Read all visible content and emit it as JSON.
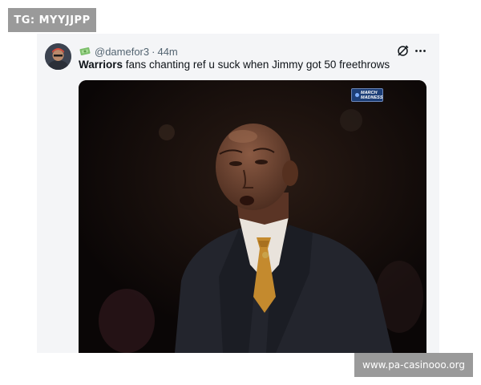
{
  "tag": "TG: MYYJJPP",
  "tweet": {
    "handle": "@damefor3",
    "separator": "·",
    "time": "44m",
    "text_bold": "Warriors",
    "text_rest": " fans chanting ref u suck when Jimmy got 50 freethrows",
    "badge_icon": "money-with-wings-icon",
    "media_badge": "MARCH MADNESS"
  },
  "watermark": "www.pa-casinooo.org",
  "colors": {
    "card_bg": "#f4f5f7",
    "tag_bg": "#9a9a9a",
    "text_main": "#0f1419",
    "text_muted": "#536471"
  }
}
